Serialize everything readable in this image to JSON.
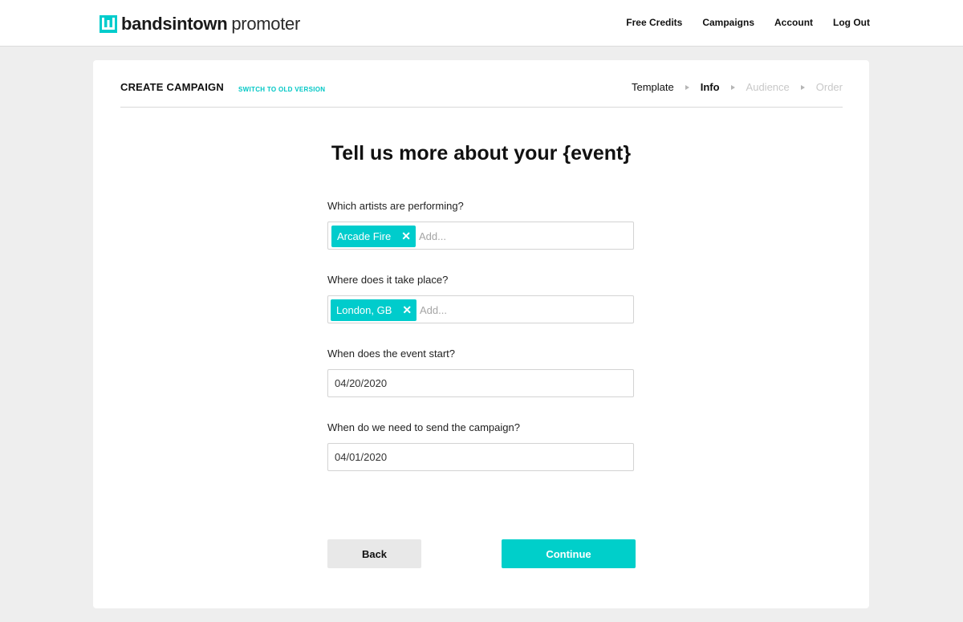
{
  "brand": {
    "name_bold": "bandsintown",
    "name_light": "promoter",
    "accent": "#00cccc"
  },
  "nav": {
    "items": [
      "Free Credits",
      "Campaigns",
      "Account",
      "Log Out"
    ]
  },
  "header": {
    "title": "CREATE CAMPAIGN",
    "switch_link": "SWITCH TO OLD VERSION",
    "steps": [
      {
        "label": "Template",
        "state": "done"
      },
      {
        "label": "Info",
        "state": "active"
      },
      {
        "label": "Audience",
        "state": "disabled"
      },
      {
        "label": "Order",
        "state": "disabled"
      }
    ]
  },
  "form": {
    "heading": "Tell us more about your {event}",
    "artists": {
      "label": "Which artists are performing?",
      "tag": "Arcade Fire",
      "placeholder": "Add..."
    },
    "location": {
      "label": "Where does it take place?",
      "tag": "London, GB",
      "placeholder": "Add..."
    },
    "event_start": {
      "label": "When does the event start?",
      "value": "04/20/2020"
    },
    "send_date": {
      "label": "When do we need to send the campaign?",
      "value": "04/01/2020"
    }
  },
  "actions": {
    "back_label": "Back",
    "continue_label": "Continue"
  }
}
